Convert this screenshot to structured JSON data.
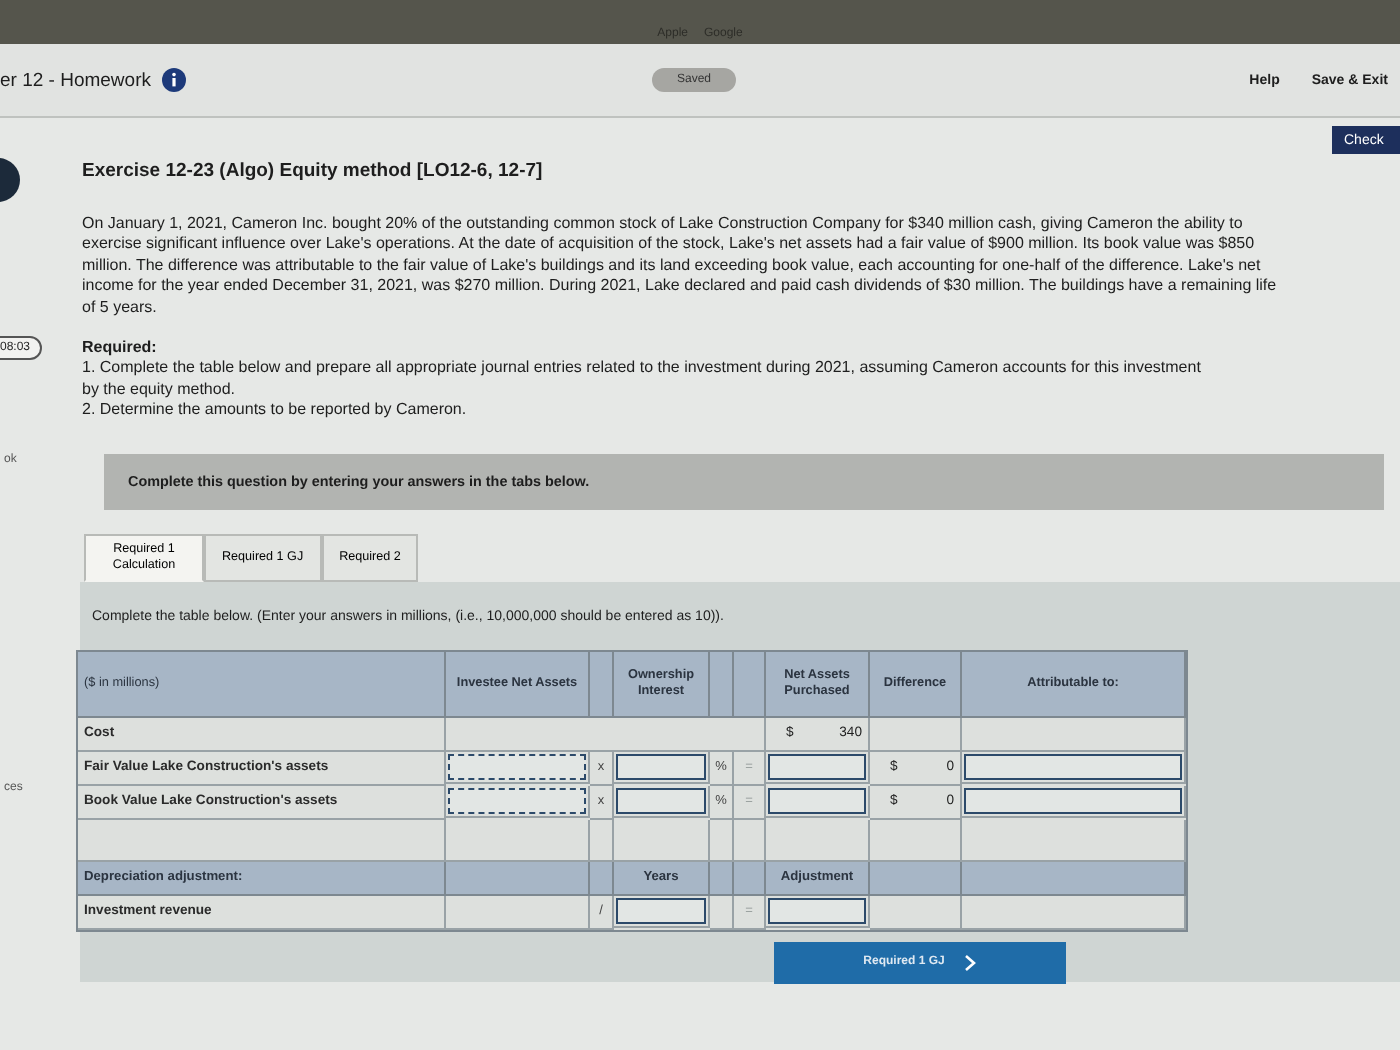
{
  "browser_bar": {
    "bookmarks": [
      "Apple",
      "Google"
    ]
  },
  "header": {
    "title": "er 12 - Homework",
    "status": "Saved",
    "links": [
      "Help",
      "Save & Exit"
    ]
  },
  "check_button": "Check",
  "sidebar": {
    "timer": "08:03",
    "labels": [
      "ok",
      "ces"
    ]
  },
  "exercise": {
    "title": "Exercise 12-23 (Algo) Equity method [LO12-6, 12-7]",
    "paragraph": "On January 1, 2021, Cameron Inc. bought 20% of the outstanding common stock of Lake Construction Company for $340 million cash, giving Cameron the ability to exercise significant influence over Lake's operations. At the date of acquisition of the stock, Lake's net assets had a fair value of $900 million. Its book value was $850 million. The difference was attributable to the fair value of Lake's buildings and its land exceeding book value, each accounting for one-half of the difference. Lake's net income for the year ended December 31, 2021, was $270 million. During 2021, Lake declared and paid cash dividends of $30 million. The buildings have a remaining life of 5 years.",
    "required_heading": "Required:",
    "requirements": [
      "1. Complete the table below and prepare all appropriate journal entries related to the investment during 2021, assuming Cameron accounts for this investment by the equity method.",
      "2. Determine the amounts to be reported by Cameron."
    ]
  },
  "banner": "Complete this question by entering your answers in the tabs below.",
  "tabs": [
    {
      "label": "Required 1 Calculation",
      "selected": true
    },
    {
      "label": "Required 1 GJ",
      "selected": false
    },
    {
      "label": "Required 2",
      "selected": false
    }
  ],
  "instruction": "Complete the table below. (Enter your answers in millions, (i.e., 10,000,000 should be entered as 10)).",
  "table": {
    "header": {
      "label": "($ in millions)",
      "investee": "Investee Net Assets",
      "ownership": "Ownership Interest",
      "purchased": "Net Assets Purchased",
      "difference": "Difference",
      "attributable": "Attributable to:"
    },
    "rows": [
      {
        "kind": "cost",
        "label": "Cost",
        "currency": "$",
        "purchased": "340"
      },
      {
        "kind": "input",
        "label": "Fair Value Lake Construction's assets",
        "operator": "x",
        "unit": "%",
        "equals": "=",
        "currency": "$",
        "difference": "0"
      },
      {
        "kind": "input",
        "label": "Book Value Lake Construction's assets",
        "operator": "x",
        "unit": "%",
        "equals": "=",
        "currency": "$",
        "difference": "0"
      },
      {
        "kind": "blank"
      },
      {
        "kind": "subheader",
        "label": "Depreciation adjustment:",
        "years": "Years",
        "adjustment": "Adjustment"
      },
      {
        "kind": "revenue",
        "label": "Investment revenue",
        "operator": "/",
        "equals": "="
      }
    ]
  },
  "next_button": "Required 1 GJ"
}
